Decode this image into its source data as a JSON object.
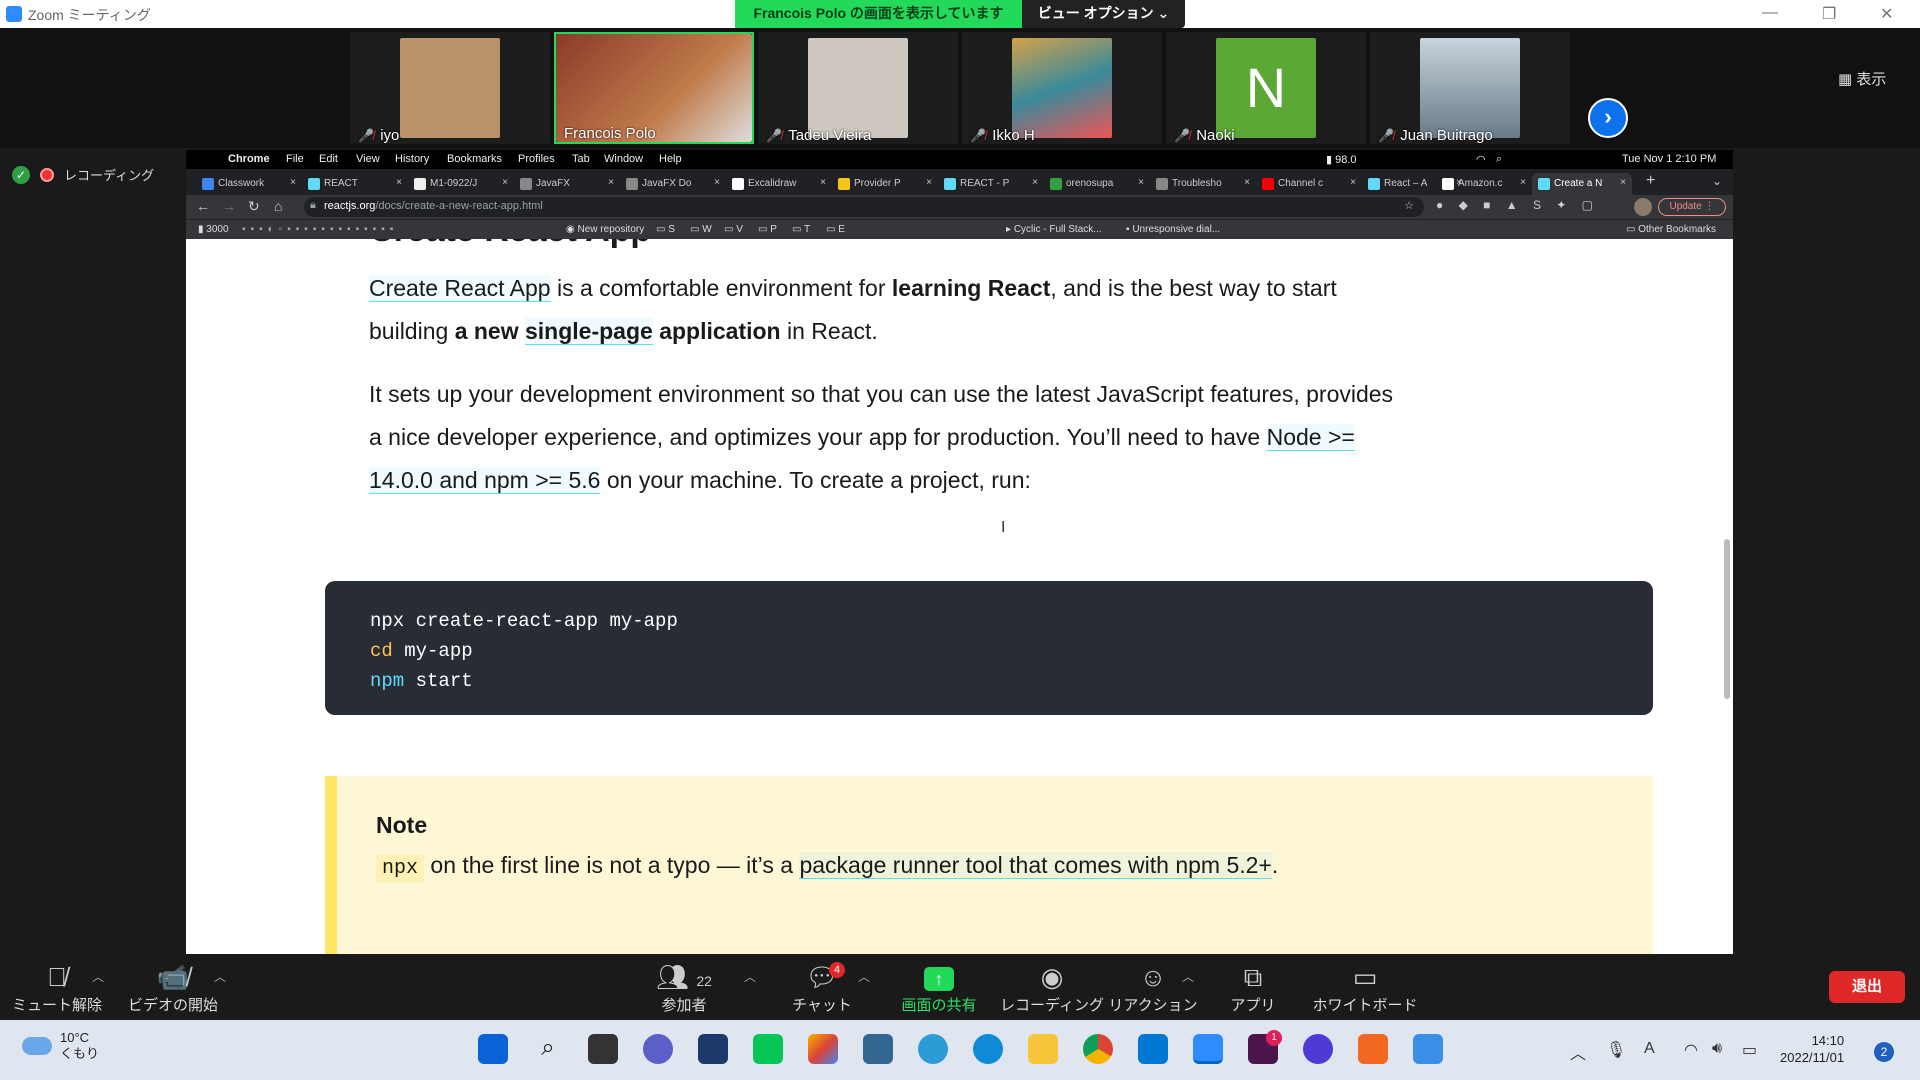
{
  "zoom": {
    "window_title": "Zoom ミーティング",
    "share_banner": "Francois  Polo の画面を表示しています",
    "view_options": "ビュー オプション ⌄",
    "view_button": "表示",
    "recording_label": "レコーディング",
    "participants": [
      {
        "name": "iyo",
        "muted": true,
        "color": "#b8926a"
      },
      {
        "name": "Francois Polo",
        "muted": false,
        "color": "#7a3a2a"
      },
      {
        "name": "Tadeu Vieira",
        "muted": true,
        "color": "#cfc8c0"
      },
      {
        "name": "Ikko H",
        "muted": true,
        "color": "#d4a24a"
      },
      {
        "name": "Naoki",
        "muted": true,
        "color": "#5ba834",
        "initial": "N"
      },
      {
        "name": "Juan Buitrago",
        "muted": true,
        "color": "#8aa0b4"
      }
    ],
    "toolbar": {
      "unmute": "ミュート解除",
      "start_video": "ビデオの開始",
      "participants": "参加者",
      "participants_count": "22",
      "chat": "チャット",
      "chat_badge": "4",
      "share_screen": "画面の共有",
      "record": "レコーディング",
      "reactions": "リアクション",
      "apps": "アプリ",
      "whiteboard": "ホワイトボード",
      "leave": "退出"
    }
  },
  "mac": {
    "menu": [
      "Chrome",
      "File",
      "Edit",
      "View",
      "History",
      "Bookmarks",
      "Profiles",
      "Tab",
      "Window",
      "Help"
    ],
    "battery": "98.0",
    "datetime": "Tue Nov 1  2:10 PM"
  },
  "browser": {
    "tabs": [
      "Classwork",
      "REACT",
      "M1-0922/J",
      "JavaFX",
      "JavaFX Do",
      "Excalidraw",
      "Provider P",
      "REACT - P",
      "orenosupa",
      "Troublesho",
      "Channel c",
      "React – A",
      "Amazon.c",
      "Create a N"
    ],
    "url_host": "reactjs.org",
    "url_path": "/docs/create-a-new-react-app.html",
    "update_label": "Update",
    "bookmarks": [
      "3000",
      "New repository",
      "S",
      "W",
      "V",
      "P",
      "T",
      "E",
      "Cyclic - Full Stack...",
      "Unresponsive dial...",
      "Other Bookmarks"
    ]
  },
  "page": {
    "heading": "Create React App",
    "p1": {
      "link1": "Create React App",
      "t1": " is a comfortable environment for ",
      "b1": "learning React",
      "t2": ", and is the best way to start building ",
      "b2": "a new ",
      "link2": "single-page",
      "b3": " application",
      "t3": " in React."
    },
    "p2": {
      "t1": "It sets up your development environment so that you can use the latest JavaScript features, provides a nice developer experience, and optimizes your app for production. You’ll need to have ",
      "link1": "Node >= 14.0.0 and npm >= 5.6",
      "t2": " on your machine. To create a project, run:"
    },
    "code": {
      "line1": "npx create-react-app my-app",
      "line2_kw": "cd",
      "line2_rest": " my-app",
      "line3_kw": "npm",
      "line3_rest": " start"
    },
    "note": {
      "title": "Note",
      "code": "npx",
      "t1": " on the first line is not a typo — it’s a ",
      "link": "package runner tool that comes with npm 5.2+",
      "t2": "."
    }
  },
  "taskbar": {
    "temperature": "10°C",
    "weather": "くもり",
    "time": "14:10",
    "date": "2022/11/01",
    "notifications": "2",
    "slack_badge": "1"
  }
}
